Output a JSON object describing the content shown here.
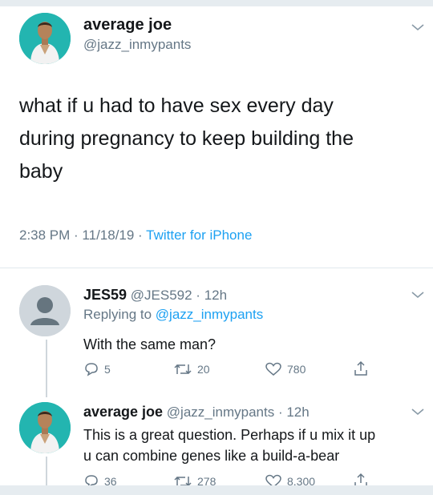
{
  "tweet": {
    "author_name": "average joe",
    "author_handle": "@jazz_inmypants",
    "text_lines": [
      "what if u had to have sex every day",
      "during pregnancy to keep building the",
      "baby"
    ],
    "timestamp": "2:38 PM · 11/18/19 · ",
    "source": "Twitter for iPhone"
  },
  "reply1": {
    "name": "JES59",
    "handle_time": "@JES592 · 12h",
    "replying_prefix": "Replying to ",
    "replying_handle": "@jazz_inmypants",
    "text": "With the same man?",
    "reply_count": "5",
    "retweet_count": "20",
    "like_count": "780"
  },
  "reply2": {
    "name": "average joe",
    "handle_time": "@jazz_inmypants · 12h",
    "text_lines": [
      "This is a great question. Perhaps if u mix it up",
      "u can combine genes like a build-a-bear"
    ],
    "reply_count": "36",
    "retweet_count": "278",
    "like_count": "8,300"
  },
  "icons": {
    "reply": "reply-icon",
    "retweet": "retweet-icon",
    "like": "heart-icon",
    "share": "share-icon",
    "more": "chevron-down-icon"
  },
  "colors": {
    "link": "#1da1f2",
    "secondary_text": "#657786",
    "avatar_bg": "#23b5b0"
  }
}
